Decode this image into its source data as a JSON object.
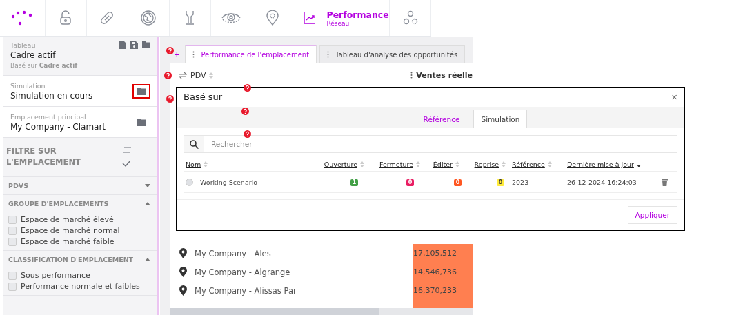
{
  "nav": {
    "items": [
      {
        "selected": false
      },
      {
        "selected": false
      },
      {
        "selected": false
      },
      {
        "selected": false
      },
      {
        "selected": false
      },
      {
        "selected": false
      },
      {
        "selected": true,
        "label": "Performance",
        "sublabel": "Réseau"
      },
      {
        "selected": false
      }
    ]
  },
  "sidebar": {
    "tableau": {
      "label": "Tableau",
      "value": "Cadre actif",
      "based_on": "Basé sur **Cadre actif**"
    },
    "simulation": {
      "label": "Simulation",
      "value": "Simulation en cours",
      "highlighted": true
    },
    "emplacement": {
      "label": "Emplacement principal",
      "value": "My Company - Clamart",
      "highlighted": false
    },
    "filter_title": "FILTRE SUR L'EMPLACEMENT",
    "sections": [
      {
        "title": "PDVS",
        "expanded": false
      },
      {
        "title": "GROUPE D'EMPLACEMENTS",
        "expanded": true,
        "options": [
          {
            "label": "Espace de marché élevé",
            "checked": false
          },
          {
            "label": "Espace de marché normal",
            "checked": false
          },
          {
            "label": "Espace de marché faible",
            "checked": false
          }
        ]
      },
      {
        "title": "CLASSIFICATION D'EMPLACEMENT",
        "expanded": true,
        "options": [
          {
            "label": "Sous-performance",
            "checked": false
          },
          {
            "label": "Performance normale et faibles",
            "checked": false
          }
        ]
      }
    ]
  },
  "main": {
    "add": "+",
    "tabs": [
      {
        "label": "Performance de l'emplacement",
        "selected": true
      },
      {
        "label": "Tableau d'analyse des opportunités",
        "selected": false
      }
    ],
    "pdv": "PDV",
    "sales": "Ventes réelle",
    "rows": [
      {
        "name": "My Company - Ales",
        "value": "17,105,512"
      },
      {
        "name": "My Company - Algrange",
        "value": "14,546,736"
      },
      {
        "name": "My Company - Alissas Par",
        "value": "16,370,233"
      }
    ]
  },
  "modal": {
    "title": "Basé sur",
    "close": "×",
    "tabs": [
      {
        "label": "Référence",
        "selected": false
      },
      {
        "label": "Simulation",
        "selected": true
      }
    ],
    "search": {
      "placeholder": "Rechercher"
    },
    "columns": [
      {
        "label": "Nom",
        "sorted": false
      },
      {
        "label": "Ouverture",
        "sorted": false
      },
      {
        "label": "Fermeture",
        "sorted": false
      },
      {
        "label": "Éditer",
        "sorted": false
      },
      {
        "label": "Reprise",
        "sorted": false
      },
      {
        "label": "Référence",
        "sorted": false
      },
      {
        "label": "Dernière mise à jour",
        "sorted": true
      }
    ],
    "rows": [
      {
        "name": "Working Scenario",
        "selected": false,
        "badges": [
          {
            "text": "1",
            "color": "#43a047"
          },
          {
            "text": "0",
            "color": "#e91e63"
          },
          {
            "text": "0",
            "color": "#ff5722"
          },
          {
            "text": "0",
            "color": "#ffeb3b"
          }
        ],
        "reference": "2023",
        "updated": "26-12-2024 16:24:03"
      }
    ],
    "apply": "Appliquer"
  }
}
